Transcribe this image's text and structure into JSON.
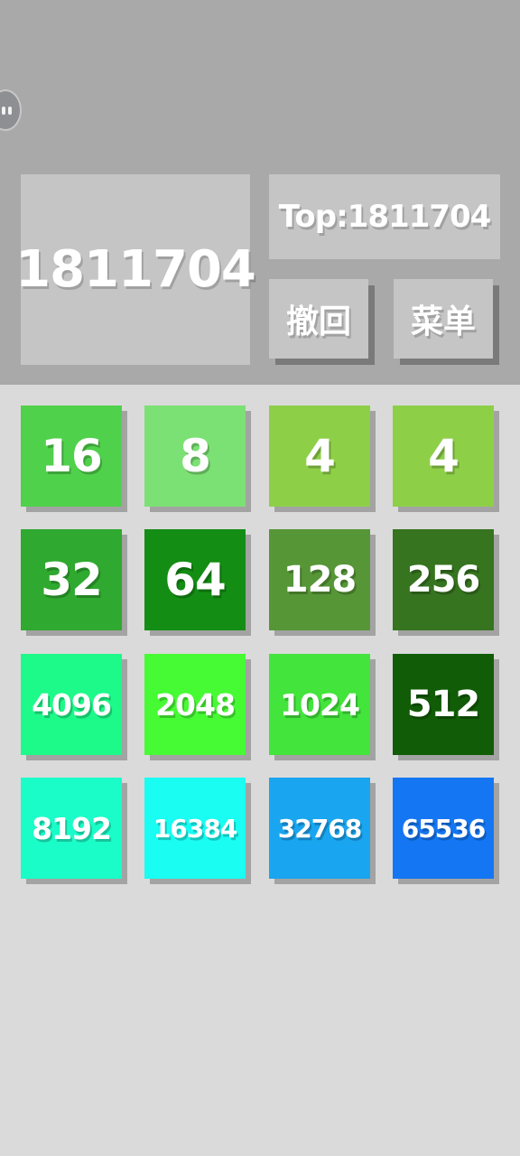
{
  "score": {
    "value": "1811704"
  },
  "top": {
    "label": "Top:1811704"
  },
  "buttons": {
    "undo": "撤回",
    "menu": "菜单"
  },
  "floating_button": {
    "icon": "face-icon"
  },
  "board": {
    "rows": [
      [
        {
          "value": "16",
          "color": "#50d14b"
        },
        {
          "value": "8",
          "color": "#7ce174"
        },
        {
          "value": "4",
          "color": "#8ecf48"
        },
        {
          "value": "4",
          "color": "#8ecf48"
        }
      ],
      [
        {
          "value": "32",
          "color": "#2fa92f"
        },
        {
          "value": "64",
          "color": "#138d13"
        },
        {
          "value": "128",
          "color": "#569637"
        },
        {
          "value": "256",
          "color": "#36741f"
        }
      ],
      [
        {
          "value": "4096",
          "color": "#1dfa8a"
        },
        {
          "value": "2048",
          "color": "#47fb34"
        },
        {
          "value": "1024",
          "color": "#43e43b"
        },
        {
          "value": "512",
          "color": "#115c06"
        }
      ],
      [
        {
          "value": "8192",
          "color": "#1afdc8"
        },
        {
          "value": "16384",
          "color": "#19fdf2"
        },
        {
          "value": "32768",
          "color": "#19a5f0"
        },
        {
          "value": "65536",
          "color": "#1476f3"
        }
      ]
    ]
  }
}
